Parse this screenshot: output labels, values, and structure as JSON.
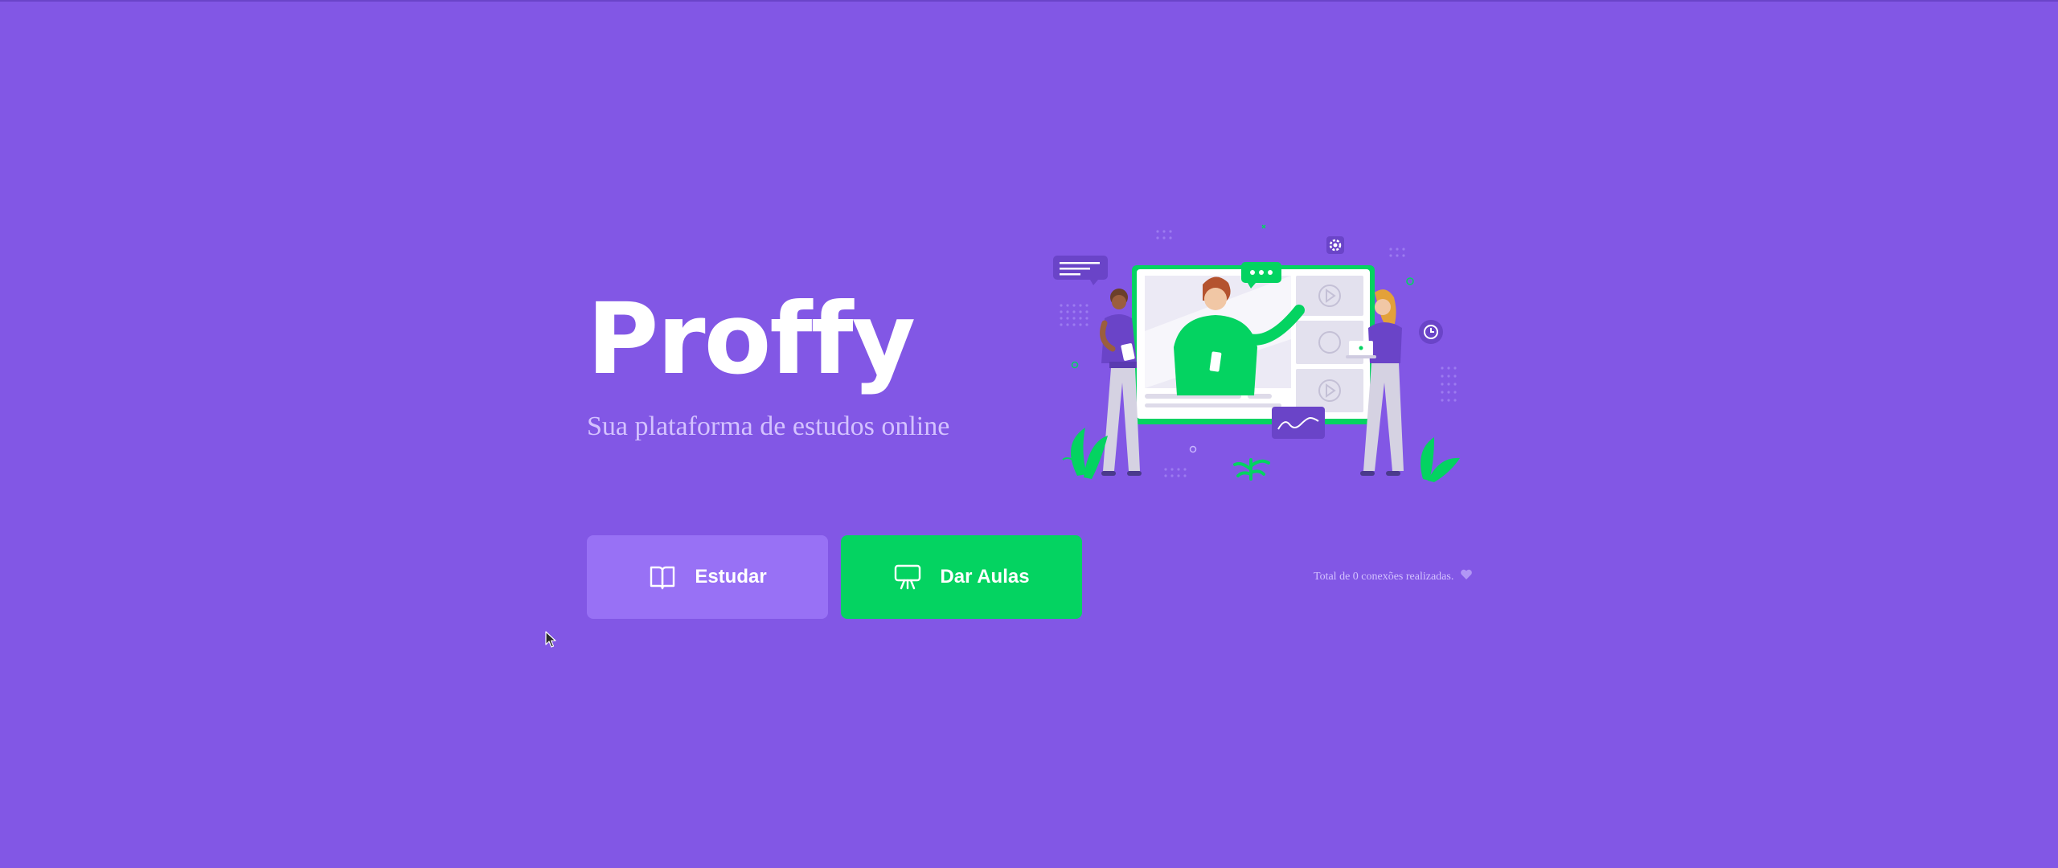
{
  "brand": {
    "logo_text": "Proffy",
    "tagline": "Sua plataforma de estudos online"
  },
  "buttons": {
    "study_label": "Estudar",
    "give_classes_label": "Dar Aulas"
  },
  "stats": {
    "total_connections_text": "Total de 0 conexões realizadas."
  },
  "icons": {
    "study": "book-open-icon",
    "give_classes": "presentation-board-icon",
    "heart": "purple-heart-icon"
  },
  "colors": {
    "background": "#8257e5",
    "study_button": "#9871f5",
    "give_classes_button": "#04d361",
    "text_light": "#d4c2ff"
  }
}
